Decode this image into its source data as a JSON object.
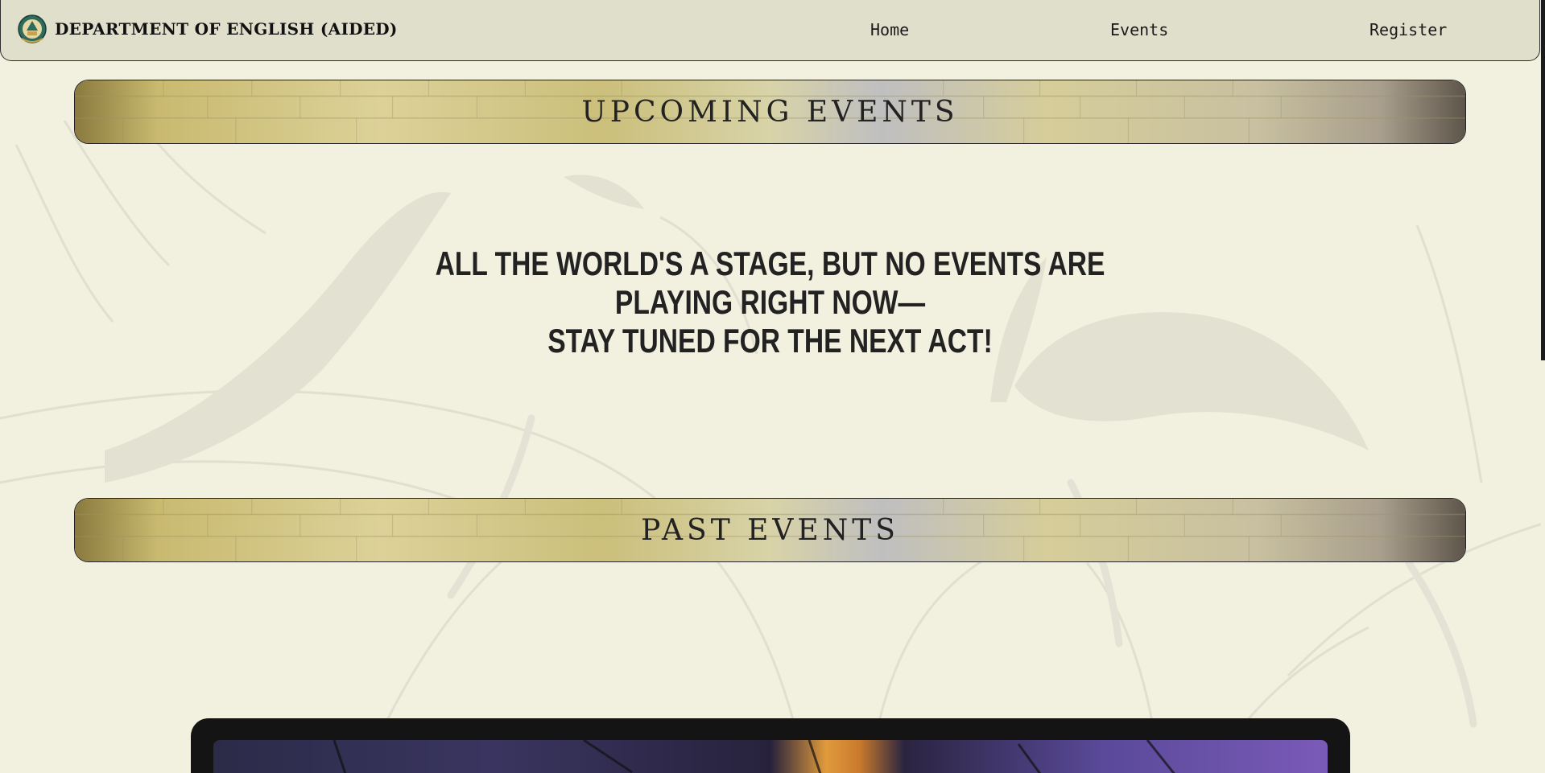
{
  "navbar": {
    "brand_name": "DEPARTMENT OF ENGLISH (AIDED)",
    "logo_icon": "college-crest-icon",
    "links": [
      {
        "label": "Home"
      },
      {
        "label": "Events"
      },
      {
        "label": "Register"
      }
    ]
  },
  "upcoming": {
    "title": "UPCOMING EVENTS",
    "message_line1": "ALL THE WORLD'S A STAGE, BUT NO EVENTS ARE PLAYING RIGHT NOW—",
    "message_line2": "STAY TUNED FOR THE NEXT ACT!"
  },
  "past": {
    "title": "PAST EVENTS"
  },
  "colors": {
    "page_background": "#f2f0df",
    "navbar_background": "#e0dfcc",
    "text_dark": "#222222",
    "gallery_frame": "#141414"
  }
}
